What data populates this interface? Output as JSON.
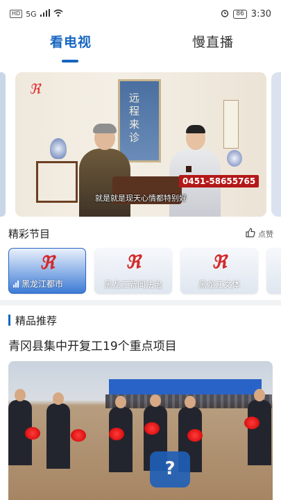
{
  "status_bar": {
    "time": "3:30",
    "battery": "86",
    "network": "5G",
    "hd": "HD"
  },
  "tabs": [
    {
      "label": "看电视",
      "active": true
    },
    {
      "label": "慢直播",
      "active": false
    }
  ],
  "video": {
    "scroll_text": "远程来诊",
    "phone": "0451-58655765",
    "subtitle": "就是就是现天心情都特别好"
  },
  "section_programs": {
    "title": "精彩节目",
    "like_label": "点赞"
  },
  "channels": [
    {
      "name": "黑龙江都市",
      "active": true
    },
    {
      "name": "黑龙江新闻法治",
      "active": false
    },
    {
      "name": "黑龙江文体",
      "active": false
    }
  ],
  "section_featured": {
    "title": "精品推荐"
  },
  "news": {
    "headline": "青冈县集中开复工19个重点项目"
  },
  "colors": {
    "accent": "#1565c0",
    "brand_red": "#d42a2a"
  }
}
